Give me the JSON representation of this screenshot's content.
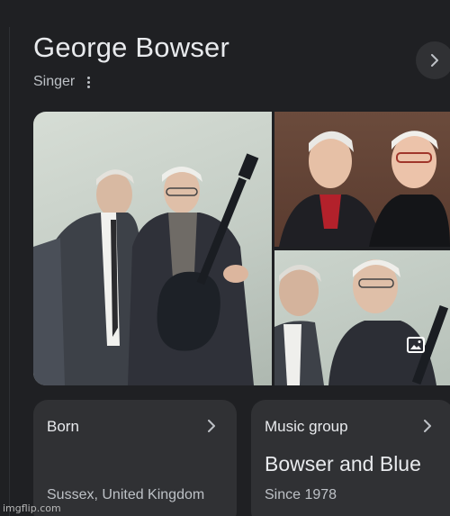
{
  "entity": {
    "name": "George Bowser",
    "type": "Singer"
  },
  "gallery": {
    "images": [
      {
        "description": "two older men in dark suits, one holding an electric guitar"
      },
      {
        "description": "two smiling older men, one wearing glasses"
      },
      {
        "description": "two older men in suits, one with a guitar"
      }
    ],
    "icon": "image-icon"
  },
  "cards": {
    "born": {
      "label": "Born",
      "value": "Sussex, United Kingdom"
    },
    "music_group": {
      "label": "Music group",
      "value": "Bowser and Blue",
      "detail": "Since 1978"
    }
  },
  "watermark": "imgflip.com",
  "colors": {
    "background": "#1f2023",
    "card": "#303134",
    "text_primary": "#e8eaed",
    "text_secondary": "#bdc1c6"
  }
}
